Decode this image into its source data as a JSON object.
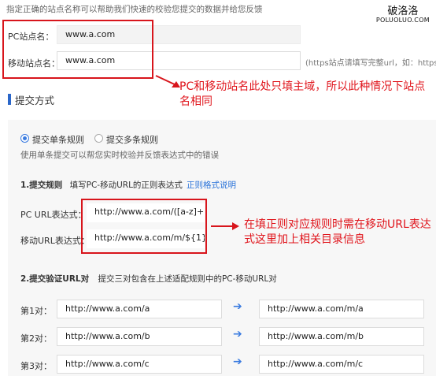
{
  "intro": "指定正确的站点名称可以帮助我们快速的校验您提交的数据并给您反馈",
  "watermark": {
    "cn": "破洛洛",
    "en": "POLUOLUO.COM"
  },
  "site": {
    "pc_label": "PC站点名：",
    "pc_value": "www.a.com",
    "mobile_label": "移动站点名：",
    "mobile_value": "www.a.com",
    "mobile_hint": "(https站点请填写完整url，如：https:/"
  },
  "note1": "PC和移动站名此处只填主域，所以此种情况下站点名相同",
  "section_title": "提交方式",
  "mode": {
    "single": "提交单条规则",
    "multi": "提交多条规则"
  },
  "single_desc": "使用单条提交可以帮您实时校验并反馈表达式中的错误",
  "step1": {
    "title": "1.提交规则",
    "desc": "填写PC-移动URL的正则表达式",
    "link": "正则格式说明"
  },
  "rule": {
    "pc_label": "PC  URL表达式：",
    "pc_value": "http://www.a.com/([a-z]+)",
    "mobile_label": "移动URL表达式：",
    "mobile_value": "http://www.a.com/m/${1}"
  },
  "note2": "在填正则对应规则时需在移动URL表达式这里加上相关目录信息",
  "step2": {
    "title": "2.提交验证URL对",
    "desc": "提交三对包含在上述适配规则中的PC-移动URL对"
  },
  "pairs": [
    {
      "label": "第1对：",
      "pc": "http://www.a.com/a",
      "mobile": "http://www.a.com/m/a"
    },
    {
      "label": "第2对：",
      "pc": "http://www.a.com/b",
      "mobile": "http://www.a.com/m/b"
    },
    {
      "label": "第3对：",
      "pc": "http://www.a.com/c",
      "mobile": "http://www.a.com/m/c"
    }
  ],
  "colors": {
    "annotation_red": "#d8151c",
    "accent_blue": "#2a66c9"
  },
  "icons": {
    "pair_arrow": "arrow-right-icon",
    "annotation_arrow": "red-arrow-icon"
  }
}
